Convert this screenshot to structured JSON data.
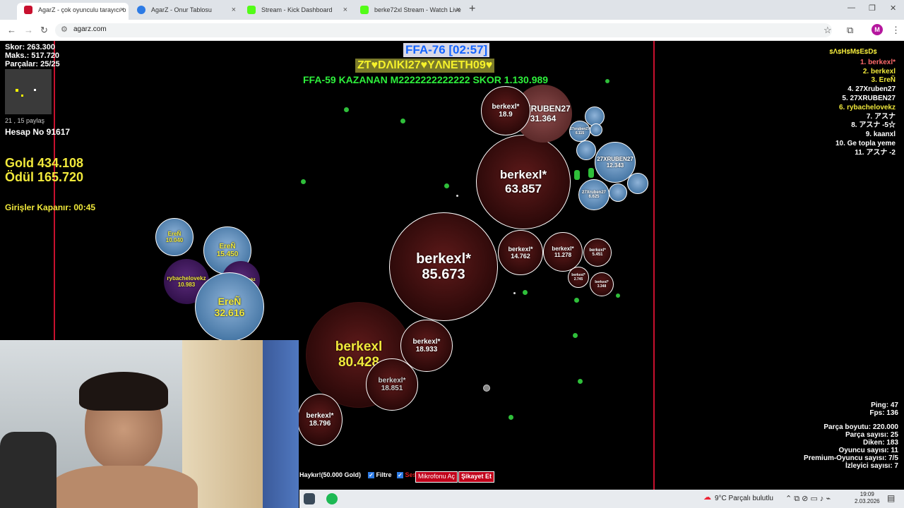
{
  "browser": {
    "tabs": [
      {
        "label": "AgarZ - çok oyunculu tarayıcı o",
        "color": "#c8102e",
        "active": true
      },
      {
        "label": "AgarZ - Onur Tablosu",
        "color": "#2d7be5",
        "active": false
      },
      {
        "label": "Stream - Kick Dashboard",
        "color": "#53fc18",
        "active": false
      },
      {
        "label": "berke72xl Stream - Watch Live",
        "color": "#53fc18",
        "active": false
      }
    ],
    "url": "agarz.com",
    "avatar_letter": "M"
  },
  "hud": {
    "score": "Skor: 263.300",
    "max": "Maks.: 517.720",
    "parts": "Parçalar: 25/25",
    "minimap_caption": "21 , 15 paylaş",
    "account": "Hesap No 91617",
    "gold": "Gold 434.108",
    "reward": "Ödül 165.720",
    "entries_close": "Girişler Kapanır: 00:45"
  },
  "banner": {
    "ffa": "FFA-76 [02:57]",
    "player": "ZƬ♥DΛlKl27♥YΛNETH09♥",
    "winner": "FFA-59 KAZANAN M2222222222222 SKOR 1.130.989"
  },
  "leaderboard": {
    "title": "ꜱΛꜱHꜱMꜱEꜱDꜱ",
    "items": [
      {
        "label": "1. berkexl*",
        "color": "#ff6b6b"
      },
      {
        "label": "2. berkexl",
        "color": "#f1e93b"
      },
      {
        "label": "3. EreÑ",
        "color": "#f1e93b"
      },
      {
        "label": "4. 27Xruben27",
        "color": "#ffffff"
      },
      {
        "label": "5. 27XRUBEN27",
        "color": "#ffffff"
      },
      {
        "label": "6. rybachelovekz",
        "color": "#f1e93b"
      },
      {
        "label": "7. アスナ",
        "color": "#ffffff"
      },
      {
        "label": "8. アスナ -5☆",
        "color": "#ffffff"
      },
      {
        "label": "9. kaanxl",
        "color": "#ffffff"
      },
      {
        "label": "10. Ge topla yeme",
        "color": "#ffffff"
      },
      {
        "label": "11. アスナ -2",
        "color": "#ffffff"
      }
    ]
  },
  "cells": {
    "big1": {
      "name": "berkexl*",
      "mass": "85.673"
    },
    "big2": {
      "name": "berkexl*",
      "mass": "63.857"
    },
    "yellow": {
      "name": "berkexl",
      "mass": "80.428"
    },
    "c1": {
      "name": "berkexl*",
      "mass": "18.933"
    },
    "c2": {
      "name": "berkexl*",
      "mass": "18.851"
    },
    "c3": {
      "name": "berkexl*",
      "mass": "18.796"
    },
    "c4": {
      "name": "berkexl*",
      "mass": "14.762"
    },
    "c5": {
      "name": "berkexl*",
      "mass": "11.278"
    },
    "c6": {
      "name": "berkexl*",
      "mass": "5.451"
    },
    "c7": {
      "name": "berkexl*",
      "mass": "2.745"
    },
    "c8": {
      "name": "berkexl*",
      "mass": "3.348"
    },
    "rb1": {
      "name": "27XRUBEN27",
      "mass": "31.364"
    },
    "rb_top": {
      "name": "berkexl*",
      "mass": "18.9"
    },
    "rb2": {
      "name": "27XRUBEN27",
      "mass": "12.343"
    },
    "rb3": {
      "name": "27Xruben27",
      "mass": "6.625"
    },
    "rb4": {
      "name": "27xruben27",
      "mass": "6.115"
    },
    "eren1": {
      "name": "EreÑ",
      "mass": "32.616"
    },
    "eren2": {
      "name": "EreÑ",
      "mass": "15.450"
    },
    "eren3": {
      "name": "EreÑ",
      "mass": "10.040"
    },
    "ryba": {
      "name": "rybachelovekz",
      "mass": "10.983"
    },
    "ryba2": {
      "name": "rybachelovekz",
      "mass": ""
    }
  },
  "stats": {
    "ping": "Ping: 47",
    "fps": "Fps: 136",
    "part_size": "Parça boyutu: 220.000",
    "part_count": "Parça sayısı: 25",
    "spikes": "Diken: 183",
    "players": "Oyuncu sayısı: 11",
    "premium": "Premium-Oyuncu sayısı: 7/5",
    "viewers": "İzleyici sayısı: 7"
  },
  "bottom": {
    "shout": "Haykır!(50.000 Gold)",
    "filter": "Filtre",
    "sound": "Ses",
    "mic": "Mikrofonu Aç",
    "report": "Şikayet Et"
  },
  "taskbar": {
    "weather": "9°C  Parçalı bulutlu",
    "time": "19:09",
    "date": "2.03.2026"
  }
}
